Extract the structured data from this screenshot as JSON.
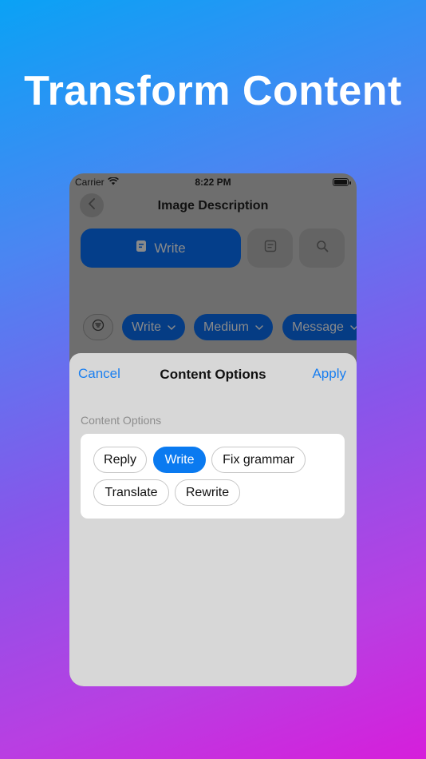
{
  "headline": "Transform Content",
  "status_bar": {
    "carrier": "Carrier",
    "time": "8:22 PM"
  },
  "nav": {
    "title": "Image Description"
  },
  "toolbar": {
    "write_label": "Write"
  },
  "filter_chips": [
    {
      "label": "Write"
    },
    {
      "label": "Medium"
    },
    {
      "label": "Message"
    }
  ],
  "sheet": {
    "cancel_label": "Cancel",
    "title": "Content Options",
    "apply_label": "Apply",
    "section_label": "Content Options",
    "options": [
      {
        "label": "Reply",
        "selected": false
      },
      {
        "label": "Write",
        "selected": true
      },
      {
        "label": "Fix grammar",
        "selected": false
      },
      {
        "label": "Translate",
        "selected": false
      },
      {
        "label": "Rewrite",
        "selected": false
      }
    ]
  },
  "colors": {
    "accent": "#0a7af0",
    "link": "#1a7ff0",
    "dimmed_primary": "#043e8a",
    "sheet_background": "#d7d7d7"
  }
}
